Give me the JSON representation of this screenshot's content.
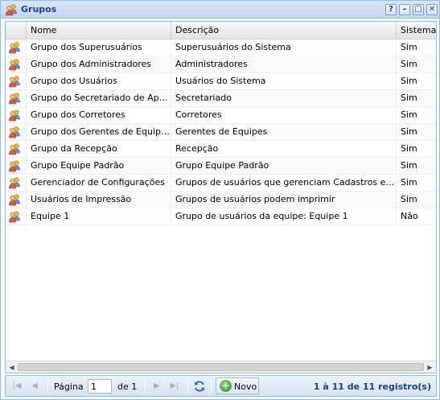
{
  "window": {
    "title": "Grupos",
    "tools": [
      "?",
      "–",
      "□",
      "✕"
    ]
  },
  "grid": {
    "columns": [
      {
        "label": ""
      },
      {
        "label": "Nome"
      },
      {
        "label": "Descrição"
      },
      {
        "label": "Sistema"
      }
    ],
    "rows": [
      {
        "nome": "Grupo dos Superusuários",
        "descricao": "Superusuários do Sistema",
        "sistema": "Sim"
      },
      {
        "nome": "Grupo dos Administradores",
        "descricao": "Administradores",
        "sistema": "Sim"
      },
      {
        "nome": "Grupo dos Usuários",
        "descricao": "Usuários do Sistema",
        "sistema": "Sim"
      },
      {
        "nome": "Grupo do Secretariado de Apoio ...",
        "descricao": "Secretariado",
        "sistema": "Sim"
      },
      {
        "nome": "Grupo dos Corretores",
        "descricao": "Corretores",
        "sistema": "Sim"
      },
      {
        "nome": "Grupo dos Gerentes de Equipes",
        "descricao": "Gerentes de Equipes",
        "sistema": "Sim"
      },
      {
        "nome": "Grupo da Recepção",
        "descricao": "Recepção",
        "sistema": "Sim"
      },
      {
        "nome": "Grupo Equipe Padrão",
        "descricao": "Grupo Equipe Padrão",
        "sistema": "Sim"
      },
      {
        "nome": "Gerenciador de Configurações",
        "descricao": "Grupos de usuários que gerenciam Cadastros e config...",
        "sistema": "Sim"
      },
      {
        "nome": "Usuários de Impressão",
        "descricao": "Grupos de usuários podem imprimir",
        "sistema": "Sim"
      },
      {
        "nome": "Equipe 1",
        "descricao": "Grupo de usuários da equipe: Equipe 1",
        "sistema": "Não"
      }
    ]
  },
  "paging": {
    "page_label": "Página",
    "page_value": "1",
    "of_label": "de 1",
    "new_button": "Novo",
    "info": "1 à 11 de 11 registro(s)"
  },
  "colors": {
    "title": "#15428b",
    "border": "#99bbe8",
    "icon_green": "#2e8c1e"
  },
  "icons": [
    "group-icon",
    "help-icon",
    "minimize-icon",
    "maximize-icon",
    "close-icon",
    "first-page-icon",
    "prev-page-icon",
    "next-page-icon",
    "last-page-icon",
    "refresh-icon",
    "add-icon"
  ]
}
